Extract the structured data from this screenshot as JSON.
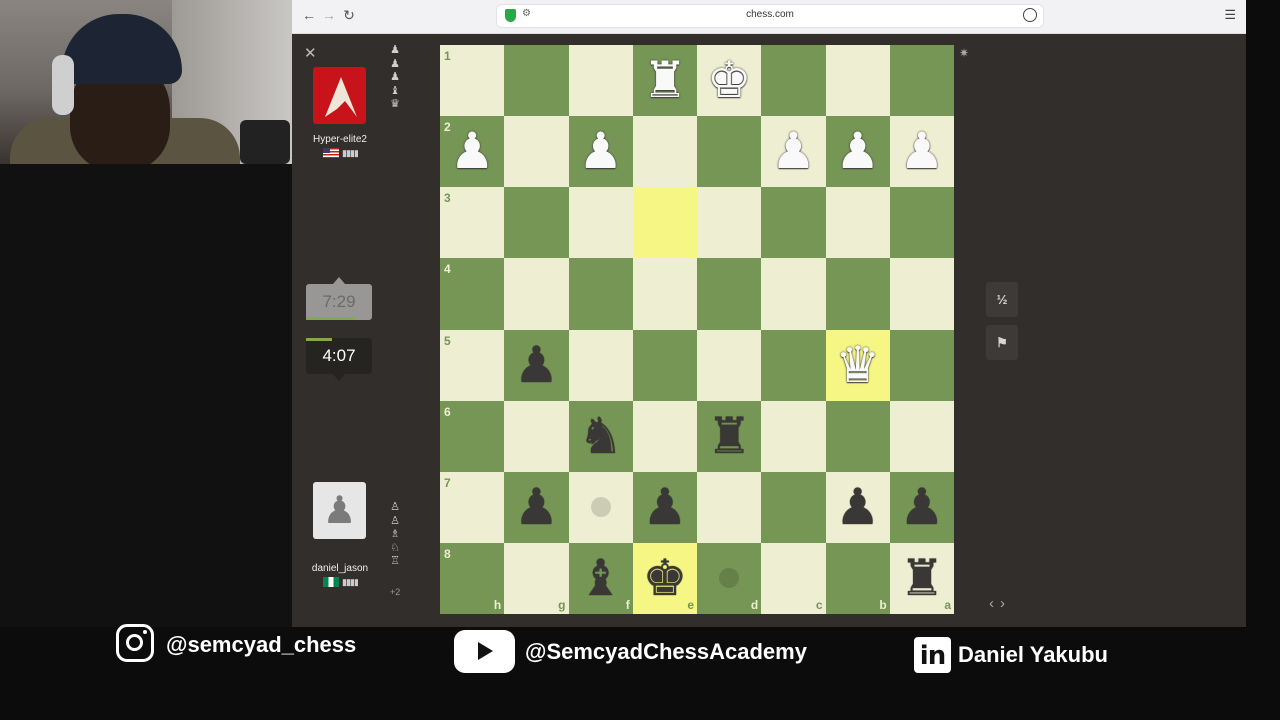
{
  "browser": {
    "url": "chess.com"
  },
  "top_player": {
    "name": "Hyper-elite2",
    "flag": "us-flag",
    "captured": [
      "♟",
      "♟",
      "♟",
      "♝",
      "♛"
    ]
  },
  "bottom_player": {
    "name": "daniel_jason",
    "flag": "nigeria-flag",
    "captured": [
      "♙",
      "♙",
      "♗",
      "♘",
      "♖"
    ],
    "material_diff": "+2"
  },
  "clocks": {
    "opponent": "7:29",
    "player": "4:07"
  },
  "controls": {
    "draw_label": "½",
    "resign_icon": "flag-icon"
  },
  "colors": {
    "light": "#eeeed2",
    "dark": "#769656",
    "highlight": "#f6f685"
  },
  "board": {
    "orientation": "black-bottom",
    "rank_labels": [
      "1",
      "2",
      "3",
      "4",
      "5",
      "6",
      "7",
      "8"
    ],
    "file_labels": [
      "h",
      "g",
      "f",
      "e",
      "d",
      "c",
      "b",
      "a"
    ],
    "highlighted": [
      "e3",
      "b5",
      "e8"
    ],
    "move_hints": [
      "f7",
      "d8"
    ],
    "pieces": {
      "e1": {
        "c": "w",
        "t": "♜"
      },
      "d1": {
        "c": "w",
        "t": "♚"
      },
      "h2": {
        "c": "w",
        "t": "♟"
      },
      "f2": {
        "c": "w",
        "t": "♟"
      },
      "c2": {
        "c": "w",
        "t": "♟"
      },
      "b2": {
        "c": "w",
        "t": "♟"
      },
      "a2": {
        "c": "w",
        "t": "♟"
      },
      "g5": {
        "c": "b",
        "t": "♟"
      },
      "b5": {
        "c": "w",
        "t": "♛"
      },
      "f6": {
        "c": "b",
        "t": "♞"
      },
      "d6": {
        "c": "b",
        "t": "♜"
      },
      "g7": {
        "c": "b",
        "t": "♟"
      },
      "e7": {
        "c": "b",
        "t": "♟"
      },
      "b7": {
        "c": "b",
        "t": "♟"
      },
      "a7": {
        "c": "b",
        "t": "♟"
      },
      "f8": {
        "c": "b",
        "t": "♝"
      },
      "e8": {
        "c": "b",
        "t": "♚"
      },
      "a8": {
        "c": "b",
        "t": "♜"
      }
    }
  },
  "footer": {
    "instagram": "@semcyad_chess",
    "youtube": "@SemcyadChessAcademy",
    "linkedin": "Daniel Yakubu",
    "linkedin_mark": "in"
  }
}
